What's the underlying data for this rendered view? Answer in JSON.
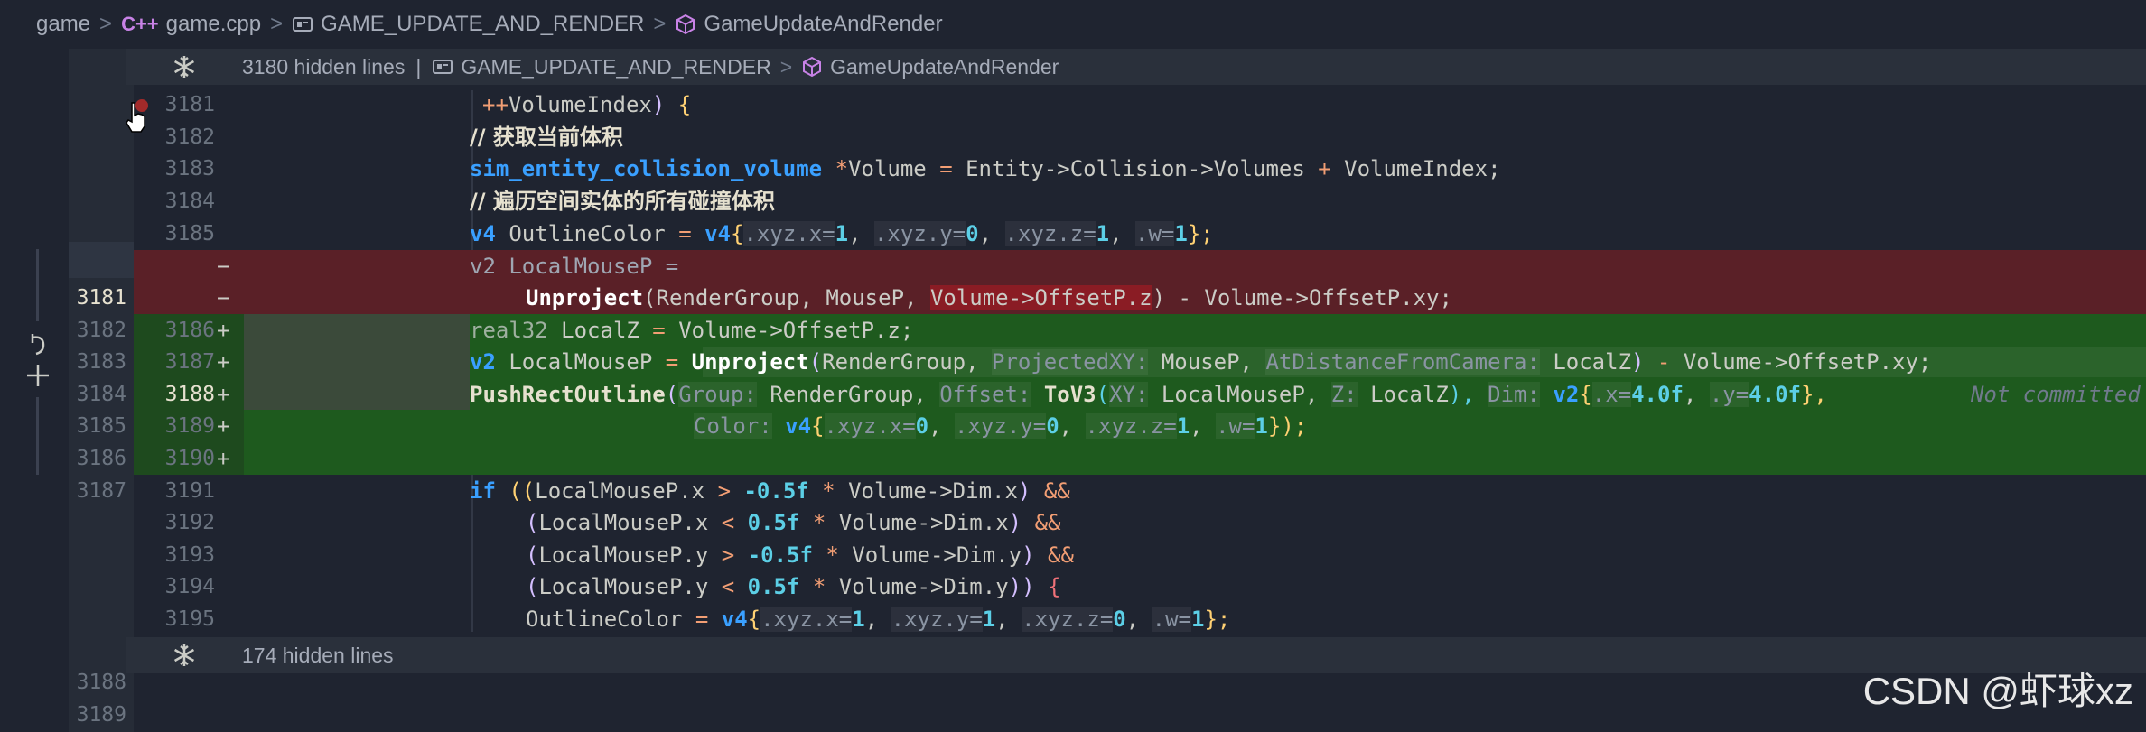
{
  "breadcrumb": {
    "folder": "game",
    "file_icon": "C++",
    "file": "game.cpp",
    "namespace": "GAME_UPDATE_AND_RENDER",
    "function": "GameUpdateAndRender"
  },
  "hidden_top": {
    "count_text": "3180 hidden lines",
    "divider": "|",
    "namespace": "GAME_UPDATE_AND_RENDER",
    "function": "GameUpdateAndRender"
  },
  "hidden_bottom": {
    "count_text": "174 hidden lines"
  },
  "icons": [
    "snowflake-icon",
    "namespace-icon",
    "function-icon",
    "pointer-hand-icon",
    "revert-icon",
    "plus-icon"
  ],
  "lines": {
    "l1": {
      "old": "",
      "new": "3181",
      "mark": ""
    },
    "l2": {
      "old": "",
      "new": "3182",
      "mark": ""
    },
    "l3": {
      "old": "",
      "new": "3183",
      "mark": ""
    },
    "l4": {
      "old": "",
      "new": "3184",
      "mark": ""
    },
    "l5": {
      "old": "",
      "new": "3185",
      "mark": ""
    },
    "l6": {
      "old": "",
      "new": "",
      "mark": "−"
    },
    "l7": {
      "old": "3181",
      "new": "",
      "mark": "−"
    },
    "l8": {
      "old": "3182",
      "new": "3186",
      "mark": "+"
    },
    "l9": {
      "old": "3183",
      "new": "3187",
      "mark": "+"
    },
    "l10": {
      "old": "3184",
      "new": "3188",
      "mark": "+"
    },
    "l11": {
      "old": "3185",
      "new": "3189",
      "mark": "+"
    },
    "l12": {
      "old": "3186",
      "new": "3190",
      "mark": "+"
    },
    "l13": {
      "old": "3187",
      "new": "3191",
      "mark": ""
    },
    "l14": {
      "old": "",
      "new": "3192",
      "mark": ""
    },
    "l15": {
      "old": "",
      "new": "3193",
      "mark": ""
    },
    "l16": {
      "old": "",
      "new": "3194",
      "mark": ""
    },
    "l17": {
      "old": "",
      "new": "3195",
      "mark": ""
    },
    "l18": {
      "old": "3188",
      "new": "",
      "mark": ""
    },
    "l19": {
      "old": "3189",
      "new": "",
      "mark": ""
    }
  },
  "code": {
    "c1a": "++",
    "c1b": "VolumeIndex",
    "c1c": ")",
    "c1d": " {",
    "c2": "// 获取当前体积",
    "c3a": "sim_entity_collision_volume",
    "c3b": " *",
    "c3c": "Volume ",
    "c3d": "=",
    "c3e": " Entity->Collision->Volumes ",
    "c3f": "+",
    "c3g": " VolumeIndex;",
    "c4": "// 遍历空间实体的所有碰撞体积",
    "c5a": "v4",
    "c5b": " OutlineColor ",
    "c5c": "=",
    "c5d": " v4",
    "c5e": "{",
    "c5f": ".xyz.x=",
    "c5g": "1",
    "c5h": ", ",
    "c5i": ".xyz.y=",
    "c5j": "0",
    "c5k": ", ",
    "c5l": ".xyz.z=",
    "c5m": "1",
    "c5n": ", ",
    "c5o": ".w=",
    "c5p": "1",
    "c5q": "};",
    "c6": "v2 LocalMouseP =",
    "c7a": "Unproject",
    "c7b": "(RenderGroup, MouseP, ",
    "c7c": "Volume->OffsetP.z",
    "c7d": ") - Volume->OffsetP.xy;",
    "c8a": "real32",
    "c8b": " LocalZ ",
    "c8c": "=",
    "c8d": " Volume->OffsetP.z;",
    "c9a": "v2",
    "c9b": " LocalMouseP ",
    "c9c": "=",
    "c9d": " ",
    "c9e": "Unproject",
    "c9f": "(",
    "c9g": "RenderGroup, ",
    "c9h": "ProjectedXY:",
    "c9i": " MouseP, ",
    "c9j": "AtDistanceFromCamera:",
    "c9k": " LocalZ",
    "c9l": ")",
    "c9m": " - ",
    "c9n": "Volume->OffsetP.xy;",
    "c10a": "PushRectOutline",
    "c10b": "(",
    "c10c": "Group:",
    "c10d": " RenderGroup, ",
    "c10e": "Offset:",
    "c10f": " ",
    "c10g": "ToV3",
    "c10h": "(",
    "c10i": "XY:",
    "c10j": " LocalMouseP, ",
    "c10k": "Z:",
    "c10l": " LocalZ",
    "c10m": "), ",
    "c10n": "Dim:",
    "c10o": " ",
    "c10p": "v2",
    "c10q": "{",
    "c10r": ".x=",
    "c10s": "4.0f",
    "c10t": ", ",
    "c10u": ".y=",
    "c10v": "4.0f",
    "c10w": "},",
    "c10note": "Not committed",
    "c11a": "Color:",
    "c11b": " ",
    "c11c": "v4",
    "c11d": "{",
    "c11e": ".xyz.x=",
    "c11f": "0",
    "c11g": ", ",
    "c11h": ".xyz.y=",
    "c11i": "0",
    "c11j": ", ",
    "c11k": ".xyz.z=",
    "c11l": "1",
    "c11m": ", ",
    "c11n": ".w=",
    "c11o": "1",
    "c11p": "});",
    "c13a": "if",
    "c13b": " ((",
    "c13c": "LocalMouseP.x ",
    "c13d": ">",
    "c13e": " ",
    "c13f": "-0.5f",
    "c13g": " ",
    "c13h": "*",
    "c13i": " Volume->Dim.x",
    "c13j": ") ",
    "c13k": "&&",
    "c14a": "(",
    "c14b": "LocalMouseP.x ",
    "c14c": "<",
    "c14d": " ",
    "c14e": "0.5f",
    "c14f": " ",
    "c14g": "*",
    "c14h": " Volume->Dim.x",
    "c14i": ") ",
    "c14j": "&&",
    "c15a": "(",
    "c15b": "LocalMouseP.y ",
    "c15c": ">",
    "c15d": " ",
    "c15e": "-0.5f",
    "c15f": " ",
    "c15g": "*",
    "c15h": " Volume->Dim.y",
    "c15i": ") ",
    "c15j": "&&",
    "c16a": "(",
    "c16b": "LocalMouseP.y ",
    "c16c": "<",
    "c16d": " ",
    "c16e": "0.5f",
    "c16f": " ",
    "c16g": "*",
    "c16h": " Volume->Dim.y",
    "c16i": "))",
    "c16j": " {",
    "c17a": "OutlineColor ",
    "c17b": "=",
    "c17c": " ",
    "c17d": "v4",
    "c17e": "{",
    "c17f": ".xyz.x=",
    "c17g": "1",
    "c17h": ", ",
    "c17i": ".xyz.y=",
    "c17j": "1",
    "c17k": ", ",
    "c17l": ".xyz.z=",
    "c17m": "0",
    "c17n": ", ",
    "c17o": ".w=",
    "c17p": "1",
    "c17q": "};"
  },
  "watermark": "CSDN @虾球xz",
  "colors": {
    "deleted": "#5a2027",
    "added": "#1e5a1e",
    "keyword": "#3aa0ff",
    "number": "#5ccfe6"
  }
}
